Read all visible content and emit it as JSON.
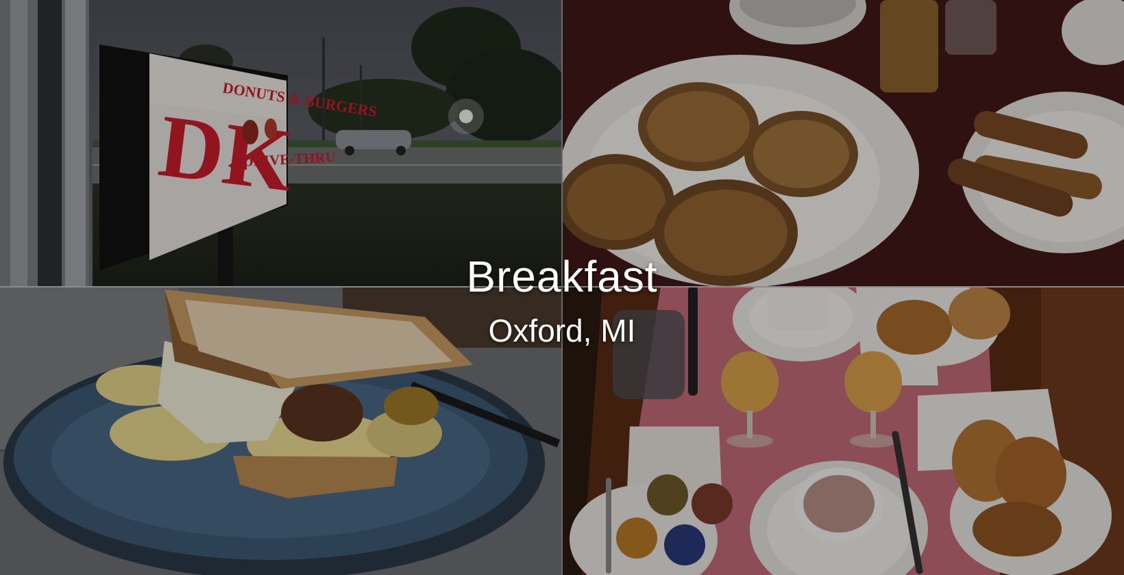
{
  "collage": {
    "title": "Breakfast",
    "subtitle": "Oxford, MI",
    "sign": {
      "monogram": "DK",
      "line1": "DONUTS & BURGERS",
      "line2": "DRIVE-THRU"
    },
    "colors": {
      "sign_red": "#c81e2a",
      "placemat_pink": "#c46b78",
      "plate_blue": "#3e5b74"
    }
  }
}
